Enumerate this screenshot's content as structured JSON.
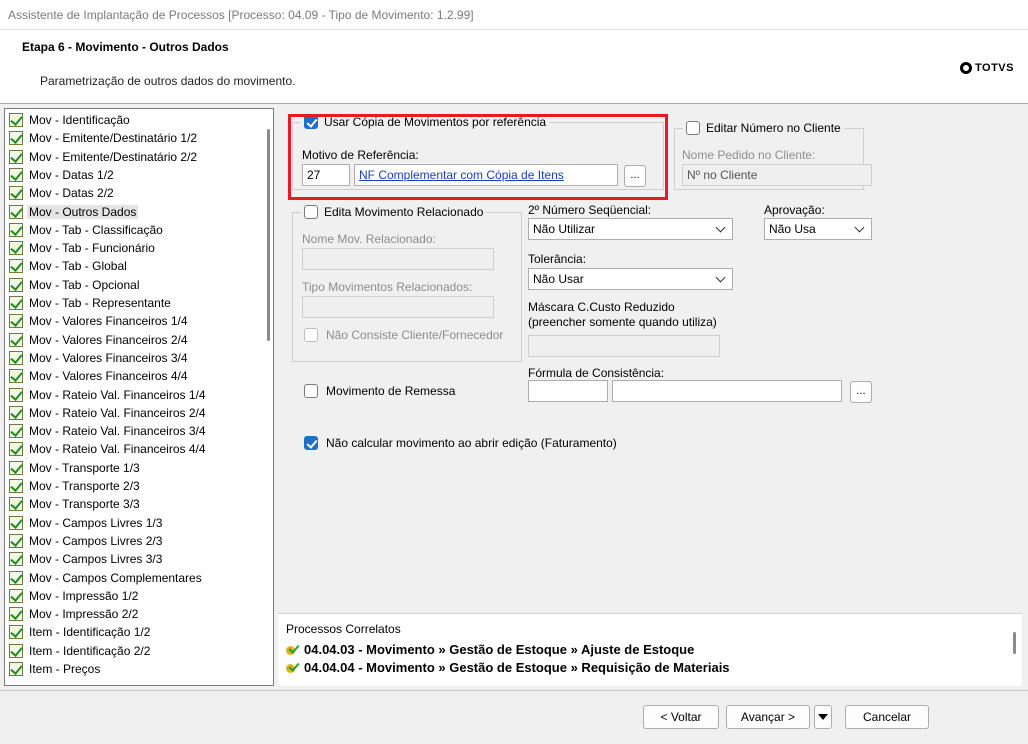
{
  "window": {
    "title": "Assistente de Implantação de Processos [Processo: 04.09 - Tipo de Movimento: 1.2.99]"
  },
  "header": {
    "step_title": "Etapa 6 - Movimento - Outros Dados",
    "step_description": "Parametrização de outros dados do movimento.",
    "brand": "TOTVS"
  },
  "steps": [
    "Mov - Identificação",
    "Mov - Emitente/Destinatário 1/2",
    "Mov - Emitente/Destinatário 2/2",
    "Mov - Datas 1/2",
    "Mov - Datas 2/2",
    "Mov - Outros Dados",
    "Mov - Tab - Classificação",
    "Mov - Tab - Funcionário",
    "Mov - Tab - Global",
    "Mov - Tab - Opcional",
    "Mov - Tab - Representante",
    "Mov - Valores Financeiros 1/4",
    "Mov - Valores Financeiros 2/4",
    "Mov - Valores Financeiros 3/4",
    "Mov - Valores Financeiros 4/4",
    "Mov - Rateio Val. Financeiros 1/4",
    "Mov - Rateio Val. Financeiros 2/4",
    "Mov - Rateio Val. Financeiros 3/4",
    "Mov - Rateio Val. Financeiros 4/4",
    "Mov - Transporte 1/3",
    "Mov - Transporte 2/3",
    "Mov - Transporte 3/3",
    "Mov - Campos Livres 1/3",
    "Mov - Campos Livres 2/3",
    "Mov - Campos Livres 3/3",
    "Mov - Campos Complementares",
    "Mov - Impressão 1/2",
    "Mov - Impressão 2/2",
    "Item - Identificação 1/2",
    "Item - Identificação 2/2",
    "Item - Preços"
  ],
  "selected_step": "Mov - Outros Dados",
  "form": {
    "copia": {
      "label": "Usar Cópia de Movimentos por referência",
      "checked": true,
      "motivo_label": "Motivo de Referência:",
      "motivo_code": "27",
      "motivo_desc": "NF Complementar com Cópia de Itens",
      "lookup_label": "..."
    },
    "editar_numero": {
      "label": "Editar Número no Cliente",
      "checked": false,
      "pedido_label": "Nome Pedido no Cliente:",
      "pedido_value": "Nº no Cliente"
    },
    "edita_mov": {
      "label": "Edita Movimento Relacionado",
      "checked": false,
      "nome_label": "Nome Mov. Relacionado:",
      "tipo_label": "Tipo Movimentos Relacionados:",
      "nao_consiste_label": "Não Consiste Cliente/Fornecedor"
    },
    "segundo_numero": {
      "label": "2º Número Seqüencial:",
      "value": "Não Utilizar"
    },
    "aprovacao": {
      "label": "Aprovação:",
      "value": "Não Usa"
    },
    "tolerancia": {
      "label": "Tolerância:",
      "value": "Não Usar"
    },
    "mascara": {
      "label_line1": "Máscara C.Custo Reduzido",
      "label_line2": "(preencher somente quando utiliza)"
    },
    "formula": {
      "label": "Fórmula de Consistência:",
      "lookup_label": "..."
    },
    "remessa": {
      "label": "Movimento de Remessa",
      "checked": false
    },
    "nao_calcular": {
      "label": "Não calcular movimento ao abrir edição (Faturamento)",
      "checked": true
    }
  },
  "correlatos": {
    "title": "Processos Correlatos",
    "items": [
      "04.04.03 - Movimento » Gestão de Estoque » Ajuste de Estoque",
      "04.04.04 - Movimento » Gestão de Estoque » Requisição de Materiais"
    ]
  },
  "footer": {
    "voltar": "< Voltar",
    "avancar": "Avançar >",
    "cancelar": "Cancelar"
  },
  "colors": {
    "highlight": "#e51c23",
    "checkbox_checked": "#1e6fc9",
    "link": "#1a3cc8"
  }
}
